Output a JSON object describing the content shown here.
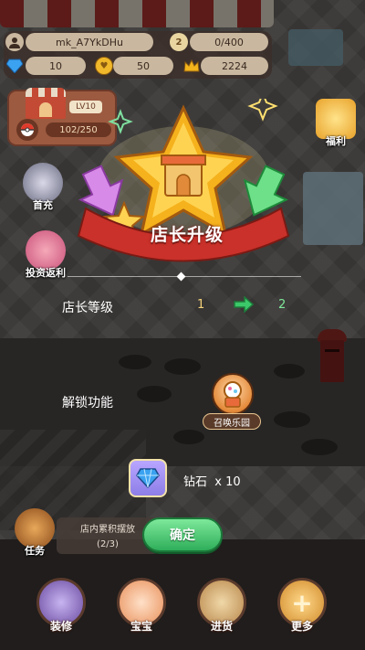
{
  "hud": {
    "username": "mk_A7YkDHu",
    "diamonds": "10",
    "coins": "50",
    "crown_points": "2224",
    "population": "0/400",
    "population_badge": "2"
  },
  "store": {
    "level": "LV10",
    "capacity": "102/250"
  },
  "side_buttons": {
    "first_charge": "首充",
    "invest": "投资返利",
    "welfare": "福利",
    "task": "任务"
  },
  "modal": {
    "title": "店长升级",
    "level_label": "店长等级",
    "level_from": "1",
    "level_to": "2",
    "unlock_label": "解锁功能",
    "unlock_feature": "召唤乐园",
    "reward_name": "钻石",
    "reward_qty": "x 10",
    "confirm": "确定"
  },
  "task_strip": {
    "line1": "店内累积摆放",
    "line2": "(2/3)"
  },
  "bottom_nav": [
    {
      "label": "装修"
    },
    {
      "label": "宝宝"
    },
    {
      "label": "进货"
    },
    {
      "label": "更多"
    }
  ],
  "colors": {
    "confirm_green": "#2fae5a",
    "banner_red": "#c9312a",
    "star_gold": "#f5b21c",
    "level_arrow_green": "#3cc86a"
  }
}
